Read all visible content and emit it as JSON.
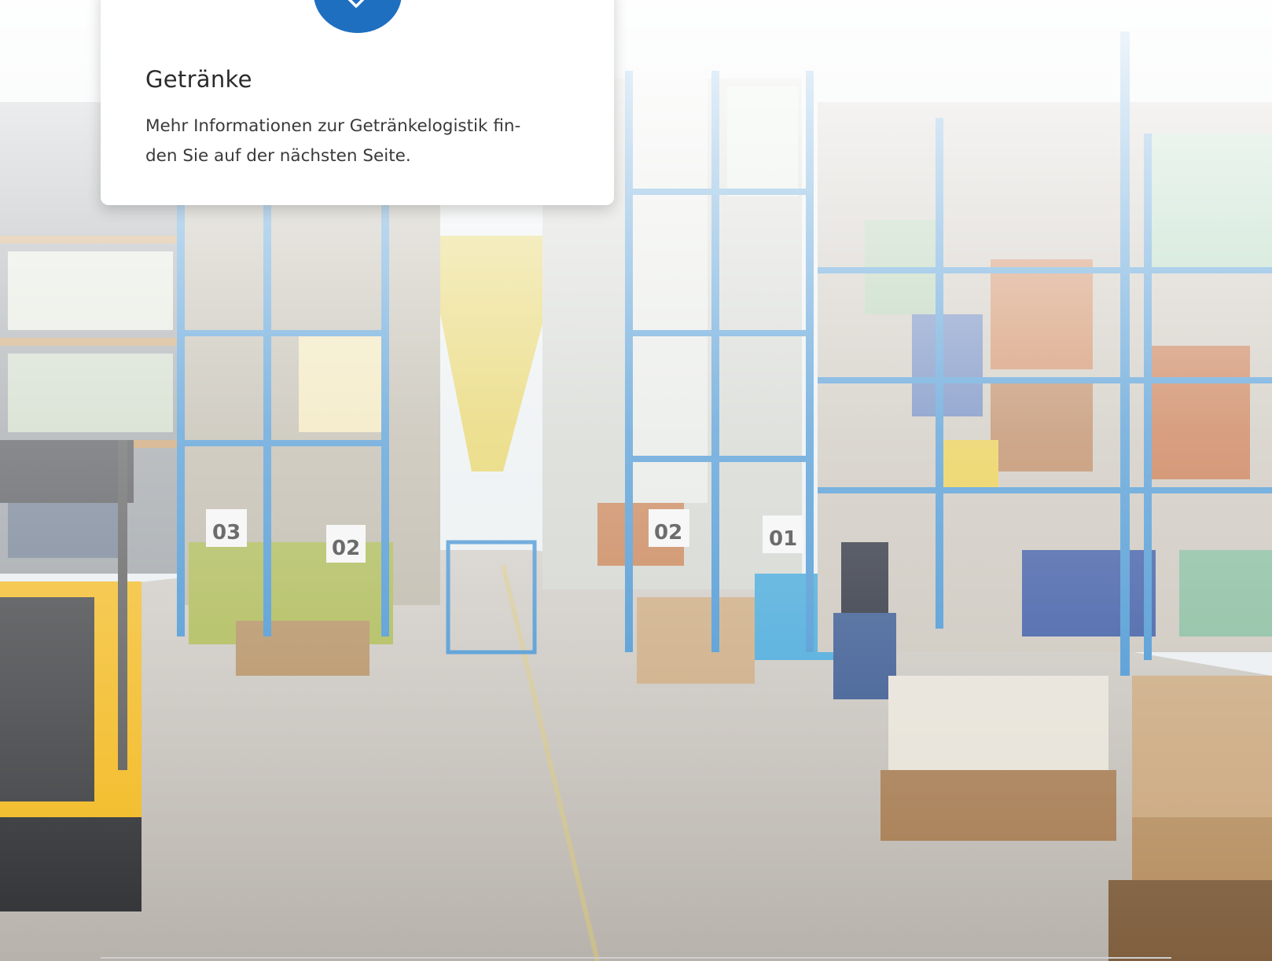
{
  "card": {
    "icon": "beverage-icon",
    "title": "Getränke",
    "text_line1": "Mehr Informationen zur Getränkelogistik fin-",
    "text_line2": "den Sie auf der nächsten Seite."
  },
  "photo": {
    "aisle_signs": [
      "03",
      "02",
      "02",
      "01"
    ]
  },
  "colors": {
    "accent": "#1f6fc0",
    "rack_blue": "#3d8fd0",
    "forklift_yellow": "#f2b81c"
  }
}
